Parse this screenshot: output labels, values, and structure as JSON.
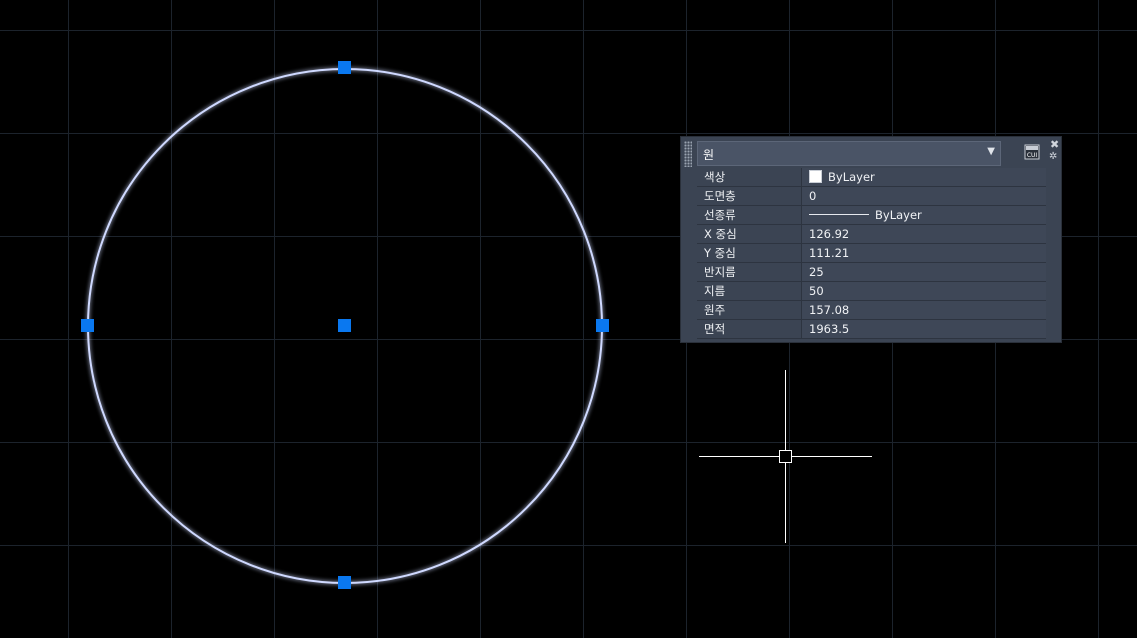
{
  "canvas": {
    "background_color": "#000000",
    "grid_color": "#1c232c",
    "circle_color": "#cfd9ff",
    "circle_glow_color": "#3b6cff",
    "grip_color": "#0a78f0",
    "cursor_color": "#ffffff"
  },
  "quick_properties": {
    "object_type": "원",
    "dropdown_icon": "chevron-down-icon",
    "customize_icon": "cui-icon",
    "close_icon": "close-icon",
    "settings_icon": "gear-icon",
    "properties": [
      {
        "label": "색상",
        "value": "ByLayer",
        "swatch_color": "#ffffff"
      },
      {
        "label": "도면층",
        "value": "0"
      },
      {
        "label": "선종류",
        "value": "ByLayer"
      },
      {
        "label": "X 중심",
        "value": "126.92"
      },
      {
        "label": "Y 중심",
        "value": "111.21"
      },
      {
        "label": "반지름",
        "value": "25"
      },
      {
        "label": "지름",
        "value": "50"
      },
      {
        "label": "원주",
        "value": "157.08"
      },
      {
        "label": "면적",
        "value": "1963.5"
      }
    ]
  }
}
